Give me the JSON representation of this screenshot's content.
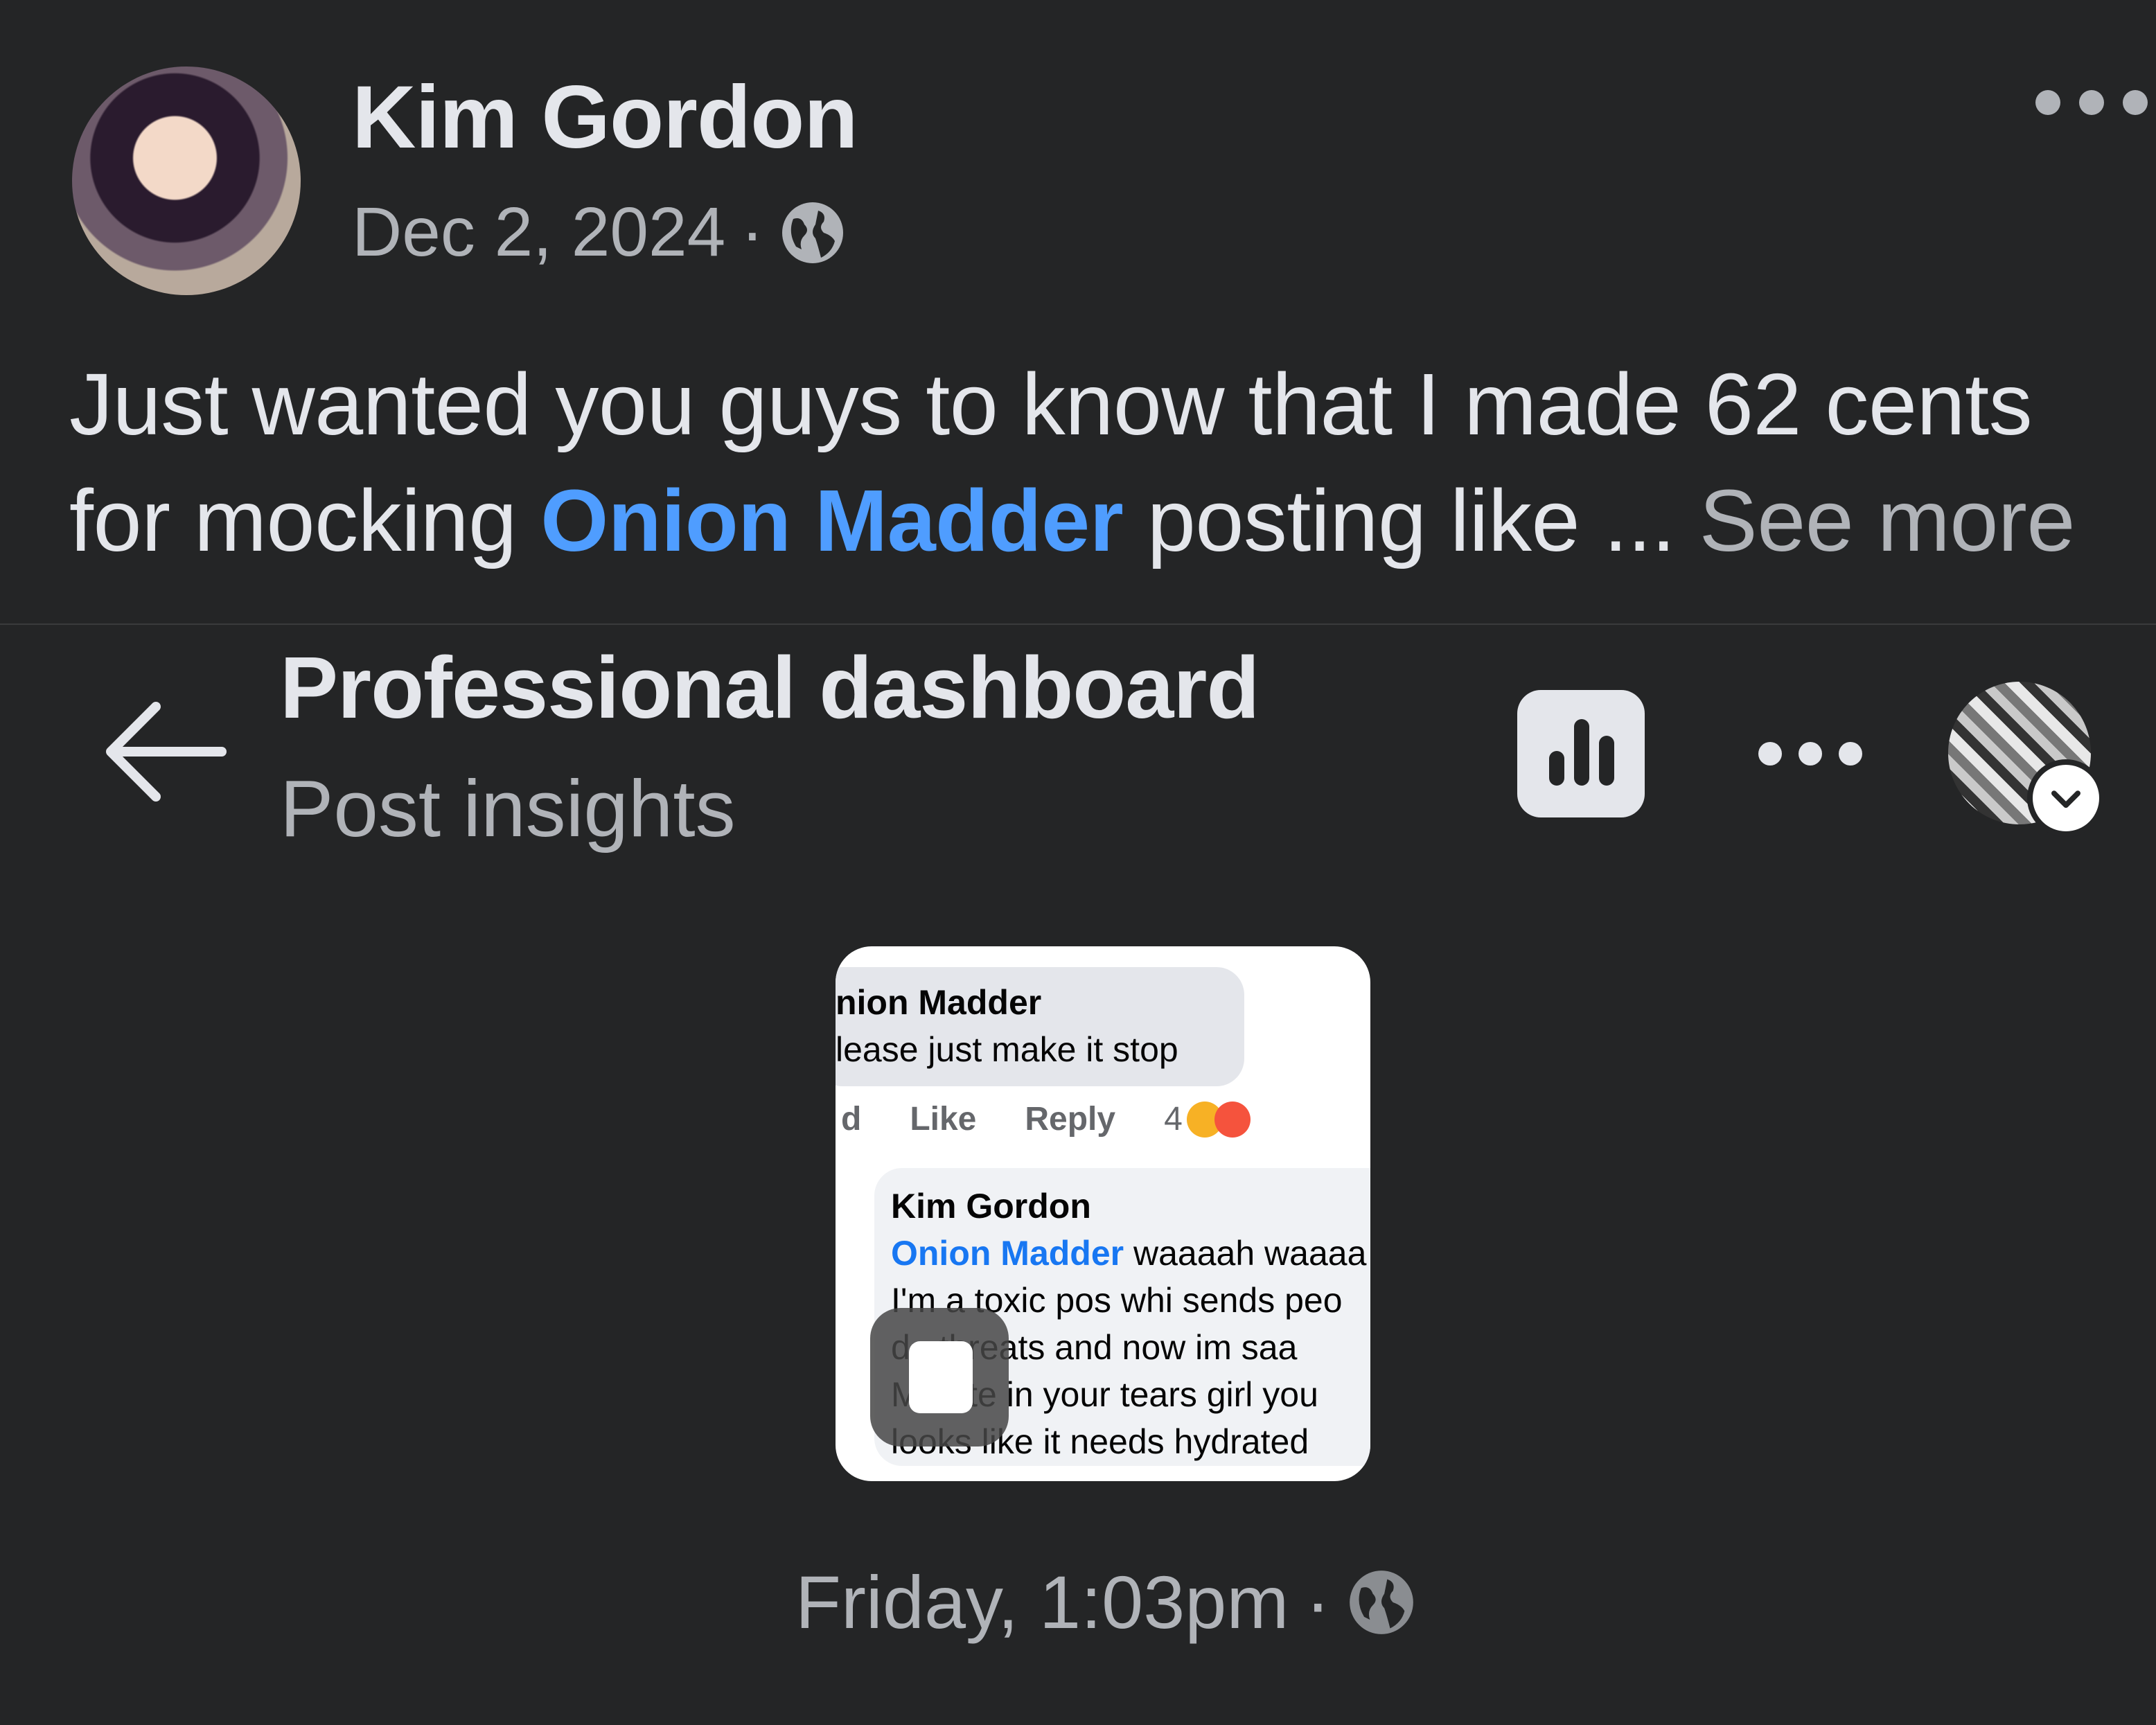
{
  "post": {
    "author": "Kim Gordon",
    "date": "Dec 2, 2024",
    "separator": "·",
    "privacy_icon": "globe-icon",
    "text_line1": "Just wanted you guys to know that I made 62 cents",
    "text_line2_prefix": "for mocking ",
    "mention": "Onion Madder",
    "text_line2_suffix": " posting like ... ",
    "see_more": "See more",
    "more_icon": "ellipsis-icon"
  },
  "shared_screenshot": {
    "title": "Professional dashboard",
    "subtitle": "Post insights",
    "back_icon": "back-arrow-icon",
    "insights_icon": "bar-chart-icon",
    "more_icon": "ellipsis-icon",
    "profile_icon": "chevron-down-icon",
    "timestamp": "Friday, 1:03pm",
    "separator": "·"
  },
  "embedded_image": {
    "comment1_name": "nion Madder",
    "comment1_text": "lease just make it stop",
    "action_time": "d",
    "action_like": "Like",
    "action_reply": "Reply",
    "reaction_count": "4",
    "comment2_name": "Kim Gordon",
    "comment2_mention": "Onion Madder",
    "comment2_line1_rest": " waaaah waaaa",
    "comment2_line2": "I'm a toxic pos whi sends peo",
    "comment2_line3": "d   threats and now im saa",
    "comment2_line4": "M   ate in your tears girl you",
    "comment2_line5": "looks like it needs hydrated"
  },
  "colors": {
    "background": "#242526",
    "mention": "#4f9dff",
    "secondary_text": "#b0b3b8"
  }
}
